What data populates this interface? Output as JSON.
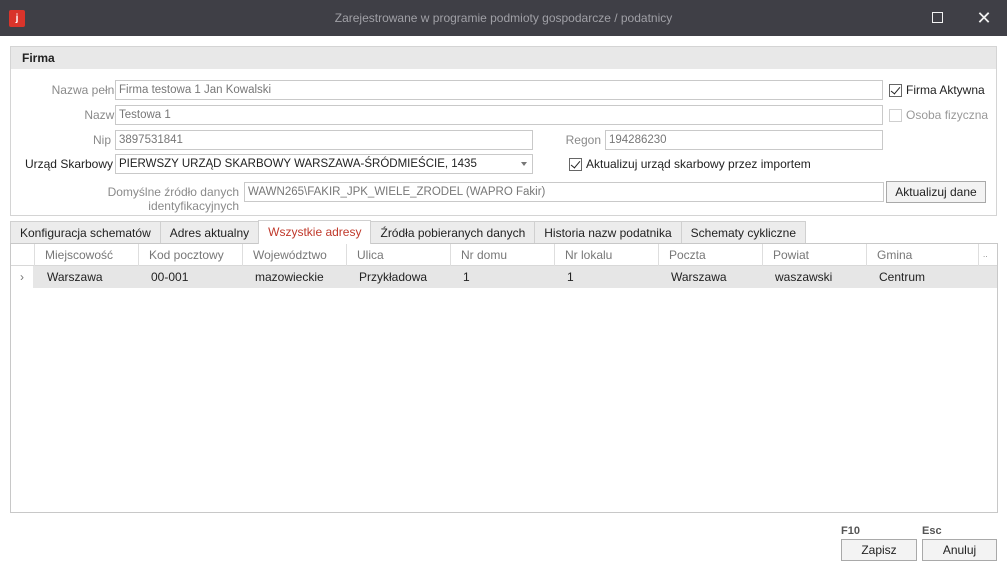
{
  "window": {
    "title": "Zarejestrowane w programie podmioty gospodarcze / podatnicy",
    "app_icon_letter": "j",
    "maximize_icon": "maximize-icon",
    "close_glyph": "✕"
  },
  "firma": {
    "header": "Firma",
    "nazwa_pelna_label": "Nazwa pełna",
    "nazwa_pelna_value": "Firma testowa 1 Jan Kowalski",
    "nazwa_label": "Nazwa",
    "nazwa_value": "Testowa 1",
    "nip_label": "Nip",
    "nip_value": "3897531841",
    "regon_label": "Regon",
    "regon_value": "194286230",
    "urzad_label": "Urząd Skarbowy",
    "urzad_value": "PIERWSZY URZĄD SKARBOWY WARSZAWA-ŚRÓDMIEŚCIE, 1435",
    "zrodlo_label": "Domyślne źródło danych identyfikacyjnych",
    "zrodlo_value": "WAWN265\\FAKIR_JPK_WIELE_ZRODEL (WAPRO Fakir)",
    "firma_aktywna_label": "Firma Aktywna",
    "firma_aktywna_checked": true,
    "osoba_fizyczna_label": "Osoba fizyczna",
    "osoba_fizyczna_checked": false,
    "aktualizuj_urzad_label": "Aktualizuj urząd skarbowy przez importem",
    "aktualizuj_urzad_checked": true,
    "aktualizuj_dane_button": "Aktualizuj dane"
  },
  "tabs": [
    {
      "label": "Konfiguracja schematów",
      "active": false
    },
    {
      "label": "Adres aktualny",
      "active": false
    },
    {
      "label": "Wszystkie adresy",
      "active": true
    },
    {
      "label": "Źródła pobieranych danych",
      "active": false
    },
    {
      "label": "Historia nazw podatnika",
      "active": false
    },
    {
      "label": "Schematy cykliczne",
      "active": false
    }
  ],
  "grid": {
    "columns": [
      "Miejscowość",
      "Kod pocztowy",
      "Województwo",
      "Ulica",
      "Nr domu",
      "Nr lokalu",
      "Poczta",
      "Powiat",
      "Gmina"
    ],
    "rows": [
      [
        "Warszawa",
        "00-001",
        "mazowieckie",
        "Przykładowa",
        "1",
        "1",
        "Warszawa",
        "waszawski",
        "Centrum"
      ]
    ],
    "row_indicator": "›",
    "extra_col_glyph": ".."
  },
  "footer": {
    "save_key": "F10",
    "save_label": "Zapisz",
    "cancel_key": "Esc",
    "cancel_label": "Anuluj"
  },
  "colors": {
    "titlebar": "#3f3f46",
    "active_tab_text": "#c0392b",
    "app_icon": "#d9342b"
  }
}
